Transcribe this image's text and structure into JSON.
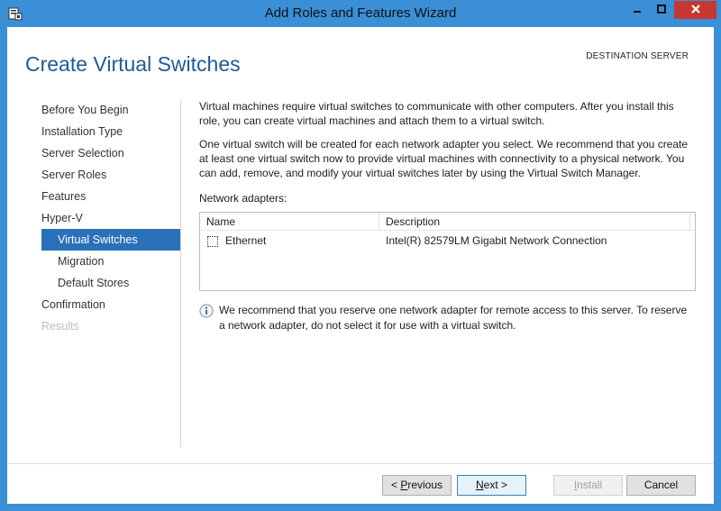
{
  "window": {
    "title": "Add Roles and Features Wizard",
    "controls": {
      "minimize": "minimize-icon",
      "maximize": "maximize-icon",
      "close": "close-icon"
    },
    "accent": "#3b8fd6",
    "close_color": "#c7372f"
  },
  "header": {
    "page_title": "Create Virtual Switches",
    "destination_label": "DESTINATION SERVER"
  },
  "nav": {
    "items": [
      {
        "label": "Before You Begin",
        "state": "normal"
      },
      {
        "label": "Installation Type",
        "state": "normal"
      },
      {
        "label": "Server Selection",
        "state": "normal"
      },
      {
        "label": "Server Roles",
        "state": "normal"
      },
      {
        "label": "Features",
        "state": "normal"
      },
      {
        "label": "Hyper-V",
        "state": "normal"
      },
      {
        "label": "Virtual Switches",
        "state": "active"
      },
      {
        "label": "Migration",
        "state": "normal"
      },
      {
        "label": "Default Stores",
        "state": "normal"
      },
      {
        "label": "Confirmation",
        "state": "normal"
      },
      {
        "label": "Results",
        "state": "disabled"
      }
    ],
    "active_color": "#2a71b9"
  },
  "content": {
    "paragraph1": "Virtual machines require virtual switches to communicate with other computers. After you install this role, you can create virtual machines and attach them to a virtual switch.",
    "paragraph2": "One virtual switch will be created for each network adapter you select. We recommend that you create at least one virtual switch now to provide virtual machines with connectivity to a physical network. You can add, remove, and modify your virtual switches later by using the Virtual Switch Manager.",
    "adapters_label": "Network adapters:",
    "table": {
      "columns": [
        "Name",
        "Description"
      ],
      "rows": [
        {
          "checked": false,
          "name": "Ethernet",
          "description": "Intel(R) 82579LM Gigabit Network Connection"
        }
      ]
    },
    "info_text": "We recommend that you reserve one network adapter for remote access to this server. To reserve a network adapter, do not select it for use with a virtual switch."
  },
  "footer": {
    "previous": {
      "prefix": "< ",
      "accel": "P",
      "rest": "revious"
    },
    "next": {
      "accel": "N",
      "rest": "ext",
      "suffix": " >"
    },
    "install": {
      "accel": "I",
      "rest": "nstall"
    },
    "cancel": "Cancel"
  }
}
